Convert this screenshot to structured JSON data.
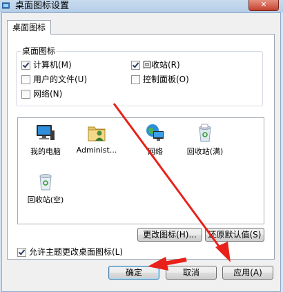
{
  "window": {
    "title": "桌面图标设置",
    "close_label": "✕"
  },
  "tabs": [
    {
      "label": "桌面图标"
    }
  ],
  "group": {
    "legend": "桌面图标",
    "checkboxes": [
      {
        "label": "计算机(M)",
        "checked": true
      },
      {
        "label": "回收站(R)",
        "checked": true
      },
      {
        "label": "用户的文件(U)",
        "checked": false
      },
      {
        "label": "控制面板(O)",
        "checked": false
      },
      {
        "label": "网络(N)",
        "checked": false
      }
    ]
  },
  "icons": [
    {
      "label": "我的电脑",
      "icon": "computer-icon"
    },
    {
      "label": "Administ...",
      "icon": "user-folder-icon"
    },
    {
      "label": "网络",
      "icon": "network-icon"
    },
    {
      "label": "回收站(满)",
      "icon": "recycle-bin-full-icon"
    },
    {
      "label": "回收站(空)",
      "icon": "recycle-bin-empty-icon"
    }
  ],
  "buttons": {
    "change_icon": "更改图标(H)...",
    "restore_default": "还原默认值(S)",
    "ok": "确定",
    "cancel": "取消",
    "apply": "应用(A)"
  },
  "allow_themes": {
    "label": "允许主题更改桌面图标(L)",
    "checked": true
  },
  "colors": {
    "annotation_arrow": "#e8211a",
    "titlebar": "#c9dcef"
  }
}
